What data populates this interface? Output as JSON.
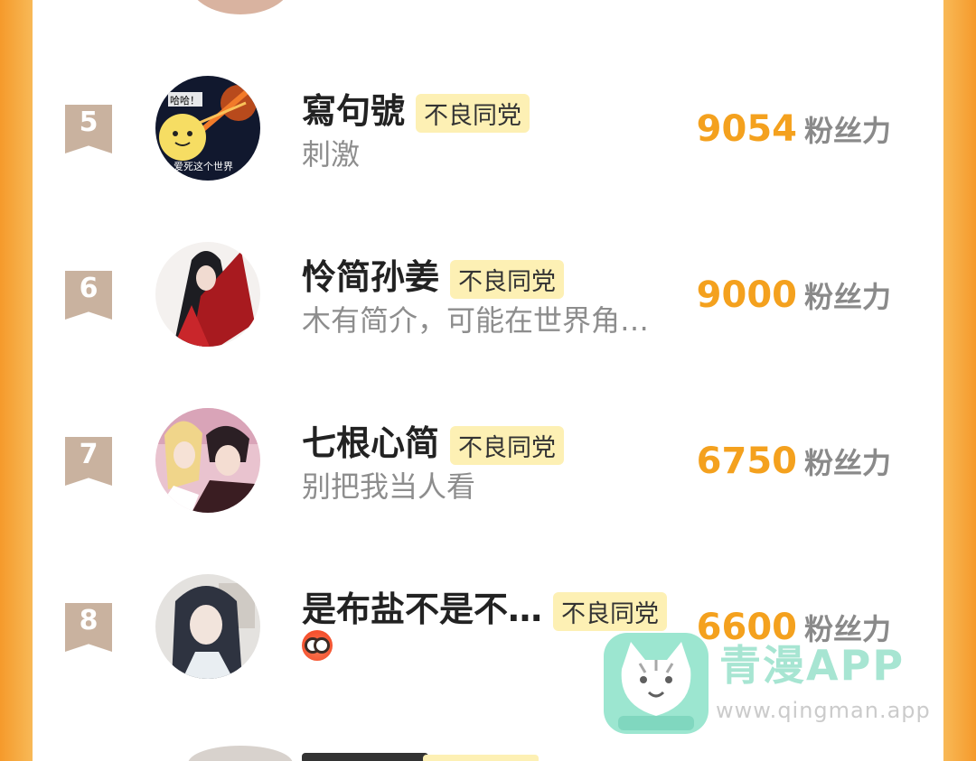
{
  "ranking": [
    {
      "rank": "5",
      "name": "寫句號",
      "badge": "不良同党",
      "bio": "刺激",
      "score": "9054",
      "unit": "粉丝力"
    },
    {
      "rank": "6",
      "name": "怜简孙姜",
      "badge": "不良同党",
      "bio": "木有简介，可能在世界角…",
      "score": "9000",
      "unit": "粉丝力"
    },
    {
      "rank": "7",
      "name": "七根心简",
      "badge": "不良同党",
      "bio": "别把我当人看",
      "score": "6750",
      "unit": "粉丝力"
    },
    {
      "rank": "8",
      "name": "是布盐不是不…",
      "badge": "不良同党",
      "bio_icon": "emoji-face-icon",
      "score": "6600",
      "unit": "粉丝力"
    }
  ],
  "avatar5_text": {
    "top": "哈哈！",
    "bottom": "爱死这个世界"
  },
  "watermark": {
    "title": "青漫APP",
    "url": "www.qingman.app"
  },
  "colors": {
    "score": "#f4a11e",
    "badge_bg": "#fdf0b4",
    "rank_bg": "#c9b29f",
    "frame": "#f6a531"
  }
}
